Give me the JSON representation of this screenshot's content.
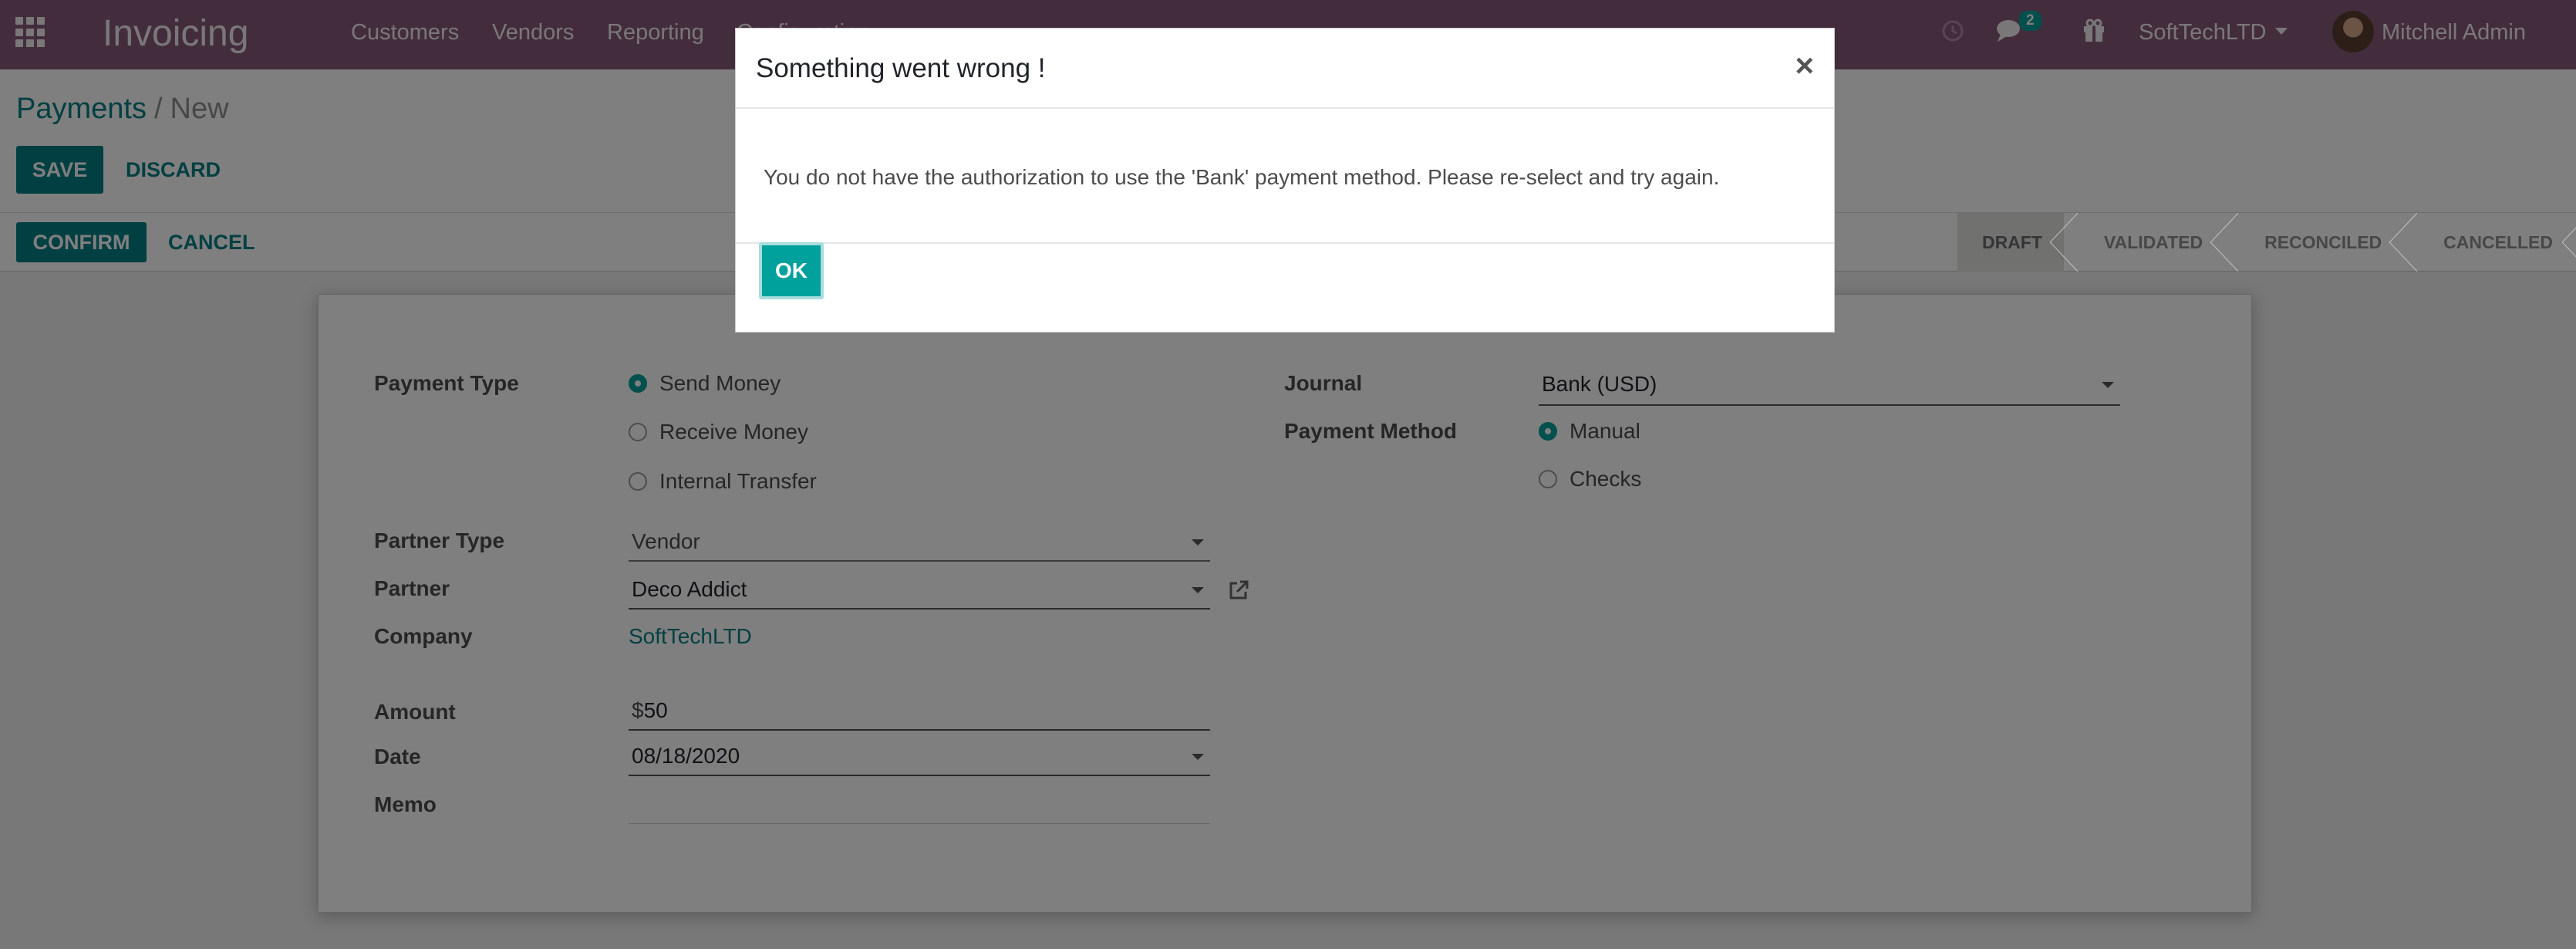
{
  "navbar": {
    "brand": "Invoicing",
    "menu": [
      "Customers",
      "Vendors",
      "Reporting",
      "Configuration"
    ],
    "messages_count": "2",
    "company": "SoftTechLTD",
    "user": "Mitchell Admin"
  },
  "breadcrumb": {
    "parent": "Payments",
    "separator": "/",
    "current": "New"
  },
  "toolbar": {
    "save": "SAVE",
    "discard": "DISCARD"
  },
  "statusbar": {
    "confirm": "CONFIRM",
    "cancel": "CANCEL",
    "steps": [
      "DRAFT",
      "VALIDATED",
      "RECONCILED",
      "CANCELLED"
    ],
    "active_step": "DRAFT"
  },
  "form": {
    "payment_type": {
      "label": "Payment Type",
      "options": [
        "Send Money",
        "Receive Money",
        "Internal Transfer"
      ],
      "selected": "Send Money"
    },
    "partner_type": {
      "label": "Partner Type",
      "value": "Vendor"
    },
    "partner": {
      "label": "Partner",
      "value": "Deco Addict"
    },
    "company": {
      "label": "Company",
      "value": "SoftTechLTD"
    },
    "amount": {
      "label": "Amount",
      "currency": "$",
      "value": "50"
    },
    "date": {
      "label": "Date",
      "value": "08/18/2020"
    },
    "memo": {
      "label": "Memo",
      "value": ""
    },
    "journal": {
      "label": "Journal",
      "value": "Bank (USD)"
    },
    "payment_method": {
      "label": "Payment Method",
      "options": [
        "Manual",
        "Checks"
      ],
      "selected": "Manual"
    }
  },
  "dialog": {
    "title": "Something went wrong !",
    "close": "×",
    "message": "You do not have the authorization to use the 'Bank' payment method. Please re-select and try again.",
    "ok": "OK"
  },
  "colors": {
    "navbar": "#875a7b",
    "primary": "#017e84",
    "accent": "#00a09d"
  }
}
